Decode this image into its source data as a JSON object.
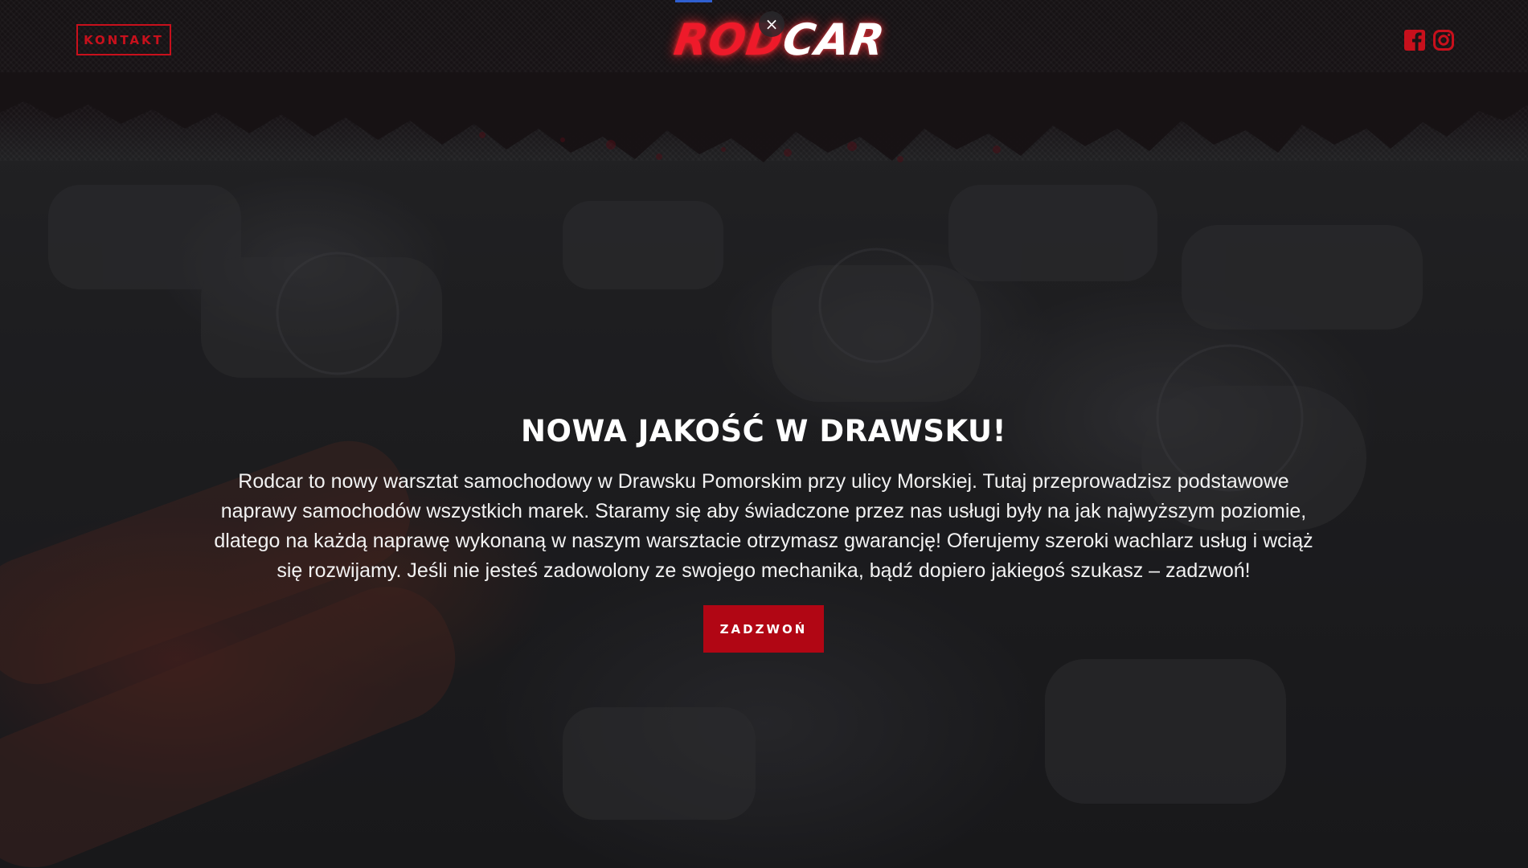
{
  "header": {
    "contact_label": "KONTAKT",
    "logo_part1": "ROD",
    "logo_part2": "CAR",
    "close_glyph": "×",
    "social_icons": [
      "facebook-icon",
      "instagram-icon"
    ]
  },
  "hero": {
    "title": "NOWA JAKOŚĆ W DRAWSKU!",
    "text": "Rodcar to nowy warsztat samochodowy w Drawsku Pomorskim przy ulicy Morskiej. Tutaj przeprowadzisz podstawowe naprawy samochodów wszystkich marek. Staramy się aby świadczone przez nas usługi były na jak najwyższym poziomie, dlatego na każdą naprawę wykonaną w naszym warsztacie otrzymasz gwarancję! Oferujemy szeroki wachlarz usług i wciąż się rozwijamy. Jeśli nie jesteś zadowolony ze swojego mechanika, bądź dopiero jakiegoś szukasz – zadzwoń!",
    "cta_label": "ZADZWOŃ"
  },
  "colors": {
    "accent_red": "#c8101c",
    "button_red": "#b10614",
    "logo_red": "#ee1a2a",
    "background": "#1a1a1b"
  }
}
